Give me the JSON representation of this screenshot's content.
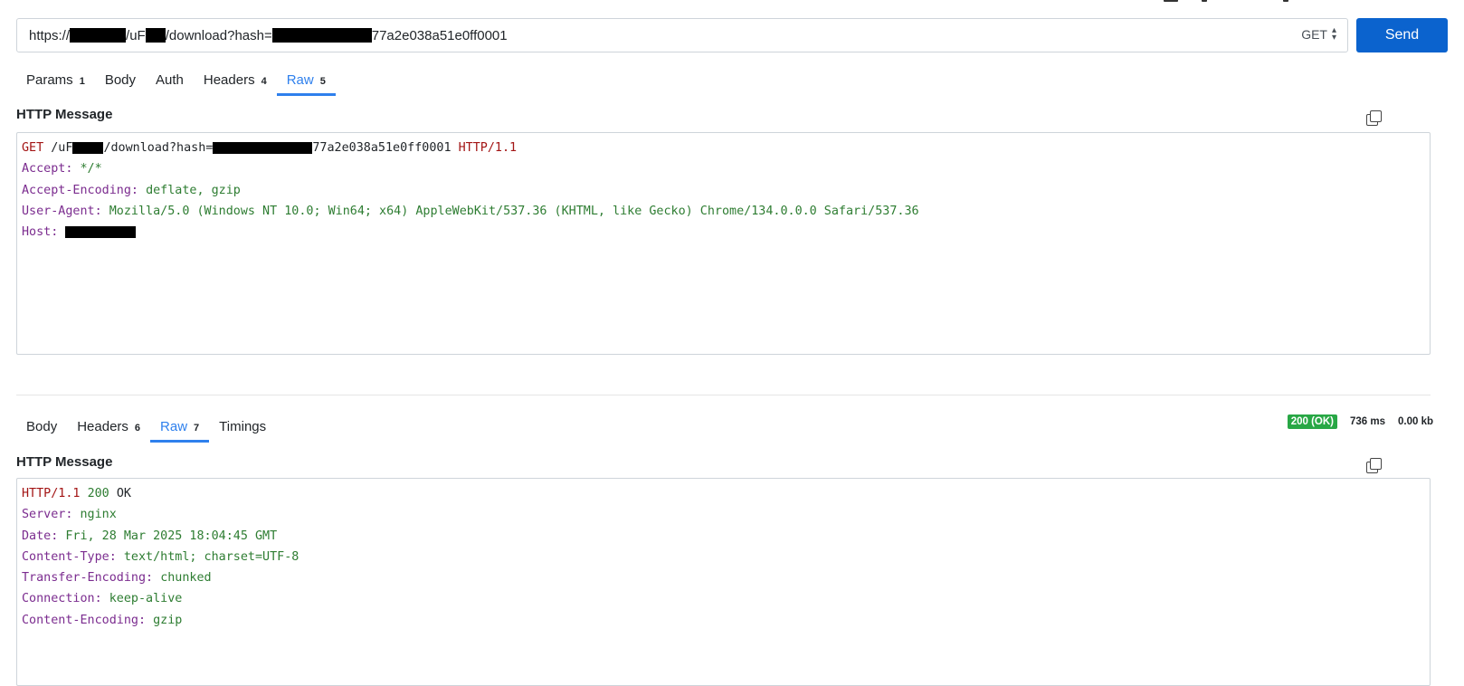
{
  "request": {
    "url_prefix": "https://",
    "url_part2": "/uF",
    "url_part3": "/download?hash=",
    "url_suffix": "77a2e038a51e0ff0001",
    "method": "GET",
    "send_label": "Send",
    "tabs": [
      {
        "label": "Params",
        "count": "1"
      },
      {
        "label": "Body",
        "count": ""
      },
      {
        "label": "Auth",
        "count": ""
      },
      {
        "label": "Headers",
        "count": "4"
      },
      {
        "label": "Raw",
        "count": "5"
      }
    ],
    "active_tab": "Raw",
    "section_title": "HTTP Message",
    "raw": {
      "method": "GET",
      "path_a": "/uF",
      "path_b": "/download?hash=",
      "path_c": "77a2e038a51e0ff0001",
      "protocol": "HTTP/1.1",
      "headers": [
        {
          "key": "Accept:",
          "value": "*/*"
        },
        {
          "key": "Accept-Encoding:",
          "value": "deflate, gzip"
        },
        {
          "key": "User-Agent:",
          "value": "Mozilla/5.0 (Windows NT 10.0; Win64; x64) AppleWebKit/537.36 (KHTML, like Gecko) Chrome/134.0.0.0 Safari/537.36"
        },
        {
          "key": "Host:",
          "value": ""
        }
      ]
    }
  },
  "response": {
    "tabs": [
      {
        "label": "Body",
        "count": ""
      },
      {
        "label": "Headers",
        "count": "6"
      },
      {
        "label": "Raw",
        "count": "7"
      },
      {
        "label": "Timings",
        "count": ""
      }
    ],
    "active_tab": "Raw",
    "status_badge": "200 (OK)",
    "time": "736 ms",
    "size": "0.00 kb",
    "section_title": "HTTP Message",
    "raw": {
      "protocol": "HTTP/1.1",
      "status_code": "200",
      "status_text": "OK",
      "headers": [
        {
          "key": "Server:",
          "value": "nginx"
        },
        {
          "key": "Date:",
          "value": "Fri, 28 Mar 2025 18:04:45 GMT"
        },
        {
          "key": "Content-Type:",
          "value": "text/html; charset=UTF-8"
        },
        {
          "key": "Transfer-Encoding:",
          "value": "chunked"
        },
        {
          "key": "Connection:",
          "value": "keep-alive"
        },
        {
          "key": "Content-Encoding:",
          "value": "gzip"
        }
      ]
    }
  },
  "colors": {
    "accent": "#2f80ed",
    "send_button": "#0b63ce",
    "status_ok": "#28a745",
    "header_key": "#7b2c8f",
    "header_value": "#2e7d32",
    "method": "#a31515"
  },
  "icons": {
    "copy": "copy-icon",
    "method_dropdown": "sort-caret-icon"
  }
}
